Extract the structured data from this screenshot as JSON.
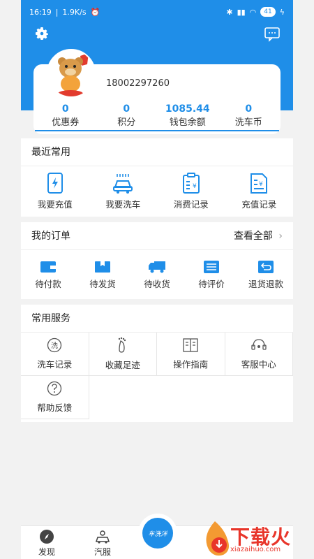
{
  "status_bar": {
    "time": "16:19",
    "speed": "1.9K/s",
    "battery": "41"
  },
  "user": {
    "phone": "18002297260"
  },
  "stats": [
    {
      "value": "0",
      "label": "优惠券"
    },
    {
      "value": "0",
      "label": "积分"
    },
    {
      "value": "1085.44",
      "label": "钱包余额"
    },
    {
      "value": "0",
      "label": "洗车币"
    }
  ],
  "recent": {
    "title": "最近常用",
    "items": [
      {
        "label": "我要充值",
        "icon": "phone-charge-icon"
      },
      {
        "label": "我要洗车",
        "icon": "car-wash-icon"
      },
      {
        "label": "消费记录",
        "icon": "consume-record-icon"
      },
      {
        "label": "充值记录",
        "icon": "recharge-record-icon"
      }
    ]
  },
  "orders": {
    "title": "我的订单",
    "more": "查看全部",
    "items": [
      {
        "label": "待付款",
        "icon": "wallet-icon"
      },
      {
        "label": "待发货",
        "icon": "package-icon"
      },
      {
        "label": "待收货",
        "icon": "truck-icon"
      },
      {
        "label": "待评价",
        "icon": "comment-icon"
      },
      {
        "label": "退货退款",
        "icon": "return-icon"
      }
    ]
  },
  "services": {
    "title": "常用服务",
    "items": [
      {
        "label": "洗车记录",
        "icon": "wash-record-icon"
      },
      {
        "label": "收藏足迹",
        "icon": "footprint-icon"
      },
      {
        "label": "操作指南",
        "icon": "book-icon"
      },
      {
        "label": "客服中心",
        "icon": "headset-icon"
      },
      {
        "label": "帮助反馈",
        "icon": "question-icon"
      }
    ]
  },
  "nav": {
    "items": [
      {
        "label": "发现",
        "icon": "compass-icon"
      },
      {
        "label": "汽服",
        "icon": "car-service-icon"
      }
    ],
    "center_logo": "车洗洋"
  },
  "watermark": {
    "text": "下载火",
    "url": "xiazaihuo.com"
  },
  "colors": {
    "brand": "#1f8ee8",
    "watermark": "#e8352a"
  }
}
